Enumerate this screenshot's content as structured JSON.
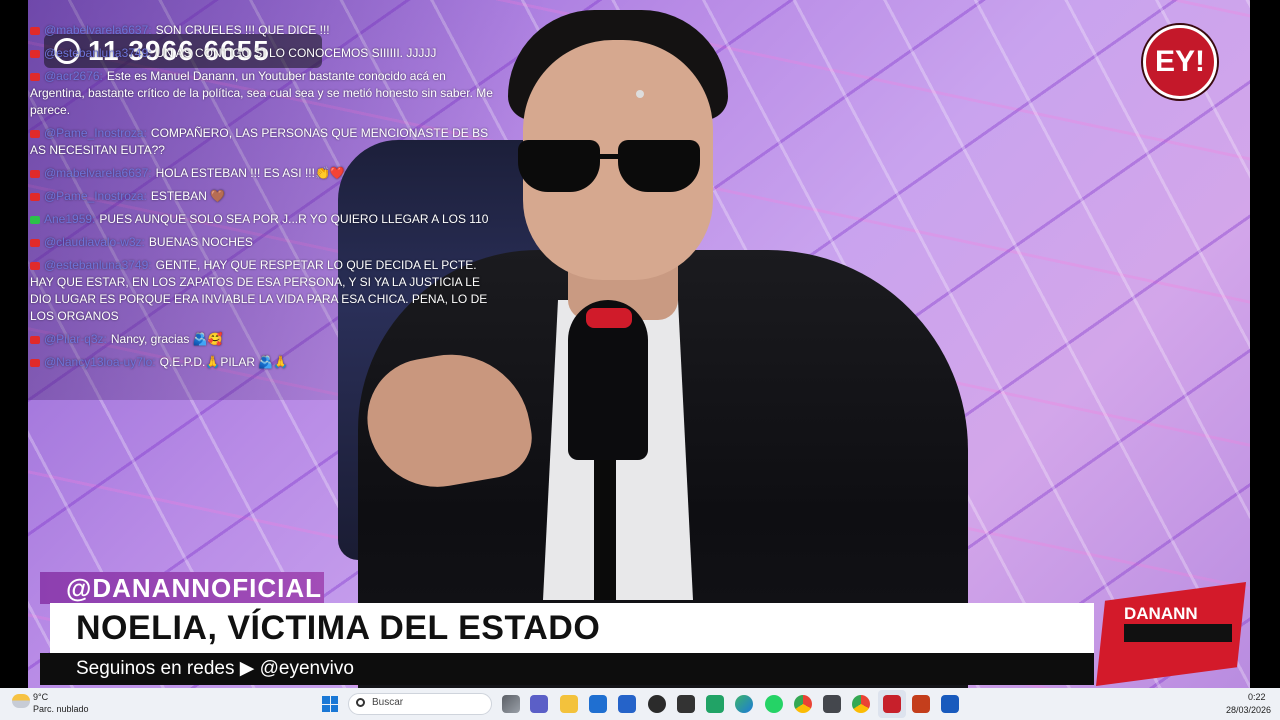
{
  "video": {
    "phone_number": "11 3966 6655",
    "channel_logo": "EY!",
    "show_logo": "DANANN",
    "handle": "@DANANNOFICIAL",
    "headline": "NOELIA, VÍCTIMA DEL ESTADO",
    "subline": "Seguinos en redes ▶ @eyenvivo"
  },
  "chat": [
    {
      "user": "@mabelvarela6637:",
      "text": "SON CRUELES !!! QUE DICE !!!",
      "badge": "youtube"
    },
    {
      "user": "@estebanluna3749:",
      "text": "UN AS CONTIGO SI LO CONOCEMOS SIIIIII. JJJJJ",
      "badge": "youtube"
    },
    {
      "user": "@acr2676:",
      "text": "Este es Manuel Danann, un Youtuber bastante conocido acá en Argentina, bastante crítico de la política, sea cual sea y se metió honesto sin saber. Me parece.",
      "badge": "youtube"
    },
    {
      "user": "@Pame_Inostroza:",
      "text": "COMPAÑERO, LAS PERSONAS QUE MENCIONASTE DE BS AS NECESITAN EUTA??",
      "badge": "youtube"
    },
    {
      "user": "@mabelvarela6637:",
      "text": "HOLA ESTEBAN !!! ES ASI !!!👏❤️",
      "badge": "youtube"
    },
    {
      "user": "@Pame_Inostroza:",
      "text": "ESTEBAN 🤎",
      "badge": "youtube"
    },
    {
      "user": "Ane1959:",
      "text": "PUES AUNQUE SOLO SEA POR J...R YO QUIERO LLEGAR A LOS 110",
      "badge": "kick"
    },
    {
      "user": "@claudiavalo-w3z:",
      "text": "BUENAS NOCHES",
      "badge": "youtube"
    },
    {
      "user": "@estebanluna3749:",
      "text": "GENTE, HAY QUE RESPETAR LO QUE DECIDA EL PCTE. HAY QUE ESTAR, EN LOS ZAPATOS DE ESA PERSONA, Y SI YA LA JUSTICIA LE DIO LUGAR ES PORQUE ERA INVIABLE LA VIDA PARA ESA CHICA. PENA, LO DE LOS ORGANOS",
      "badge": "youtube"
    },
    {
      "user": "@Pilar-q3z:",
      "text": "Nancy, gracias 🫂🥰",
      "badge": "youtube"
    },
    {
      "user": "@Nancy13loa-uy7lo:",
      "text": "Q.E.P.D.🙏PILAR 🫂🙏",
      "badge": "youtube"
    }
  ],
  "taskbar": {
    "weather_temp": "9°C",
    "weather_desc": "Parc. nublado",
    "search_placeholder": "Buscar",
    "time": "0:22",
    "date": "28/03/2026",
    "apps": [
      "task-view-icon",
      "teams-icon",
      "file-explorer-icon",
      "store-icon",
      "mail-icon",
      "chatgpt-icon",
      "app-icon",
      "spreadsheet-icon",
      "edge-icon",
      "whatsapp-icon",
      "chrome-icon",
      "vpn-icon",
      "chrome-profile-icon",
      "video-app-icon",
      "powerpoint-icon",
      "word-icon"
    ]
  }
}
